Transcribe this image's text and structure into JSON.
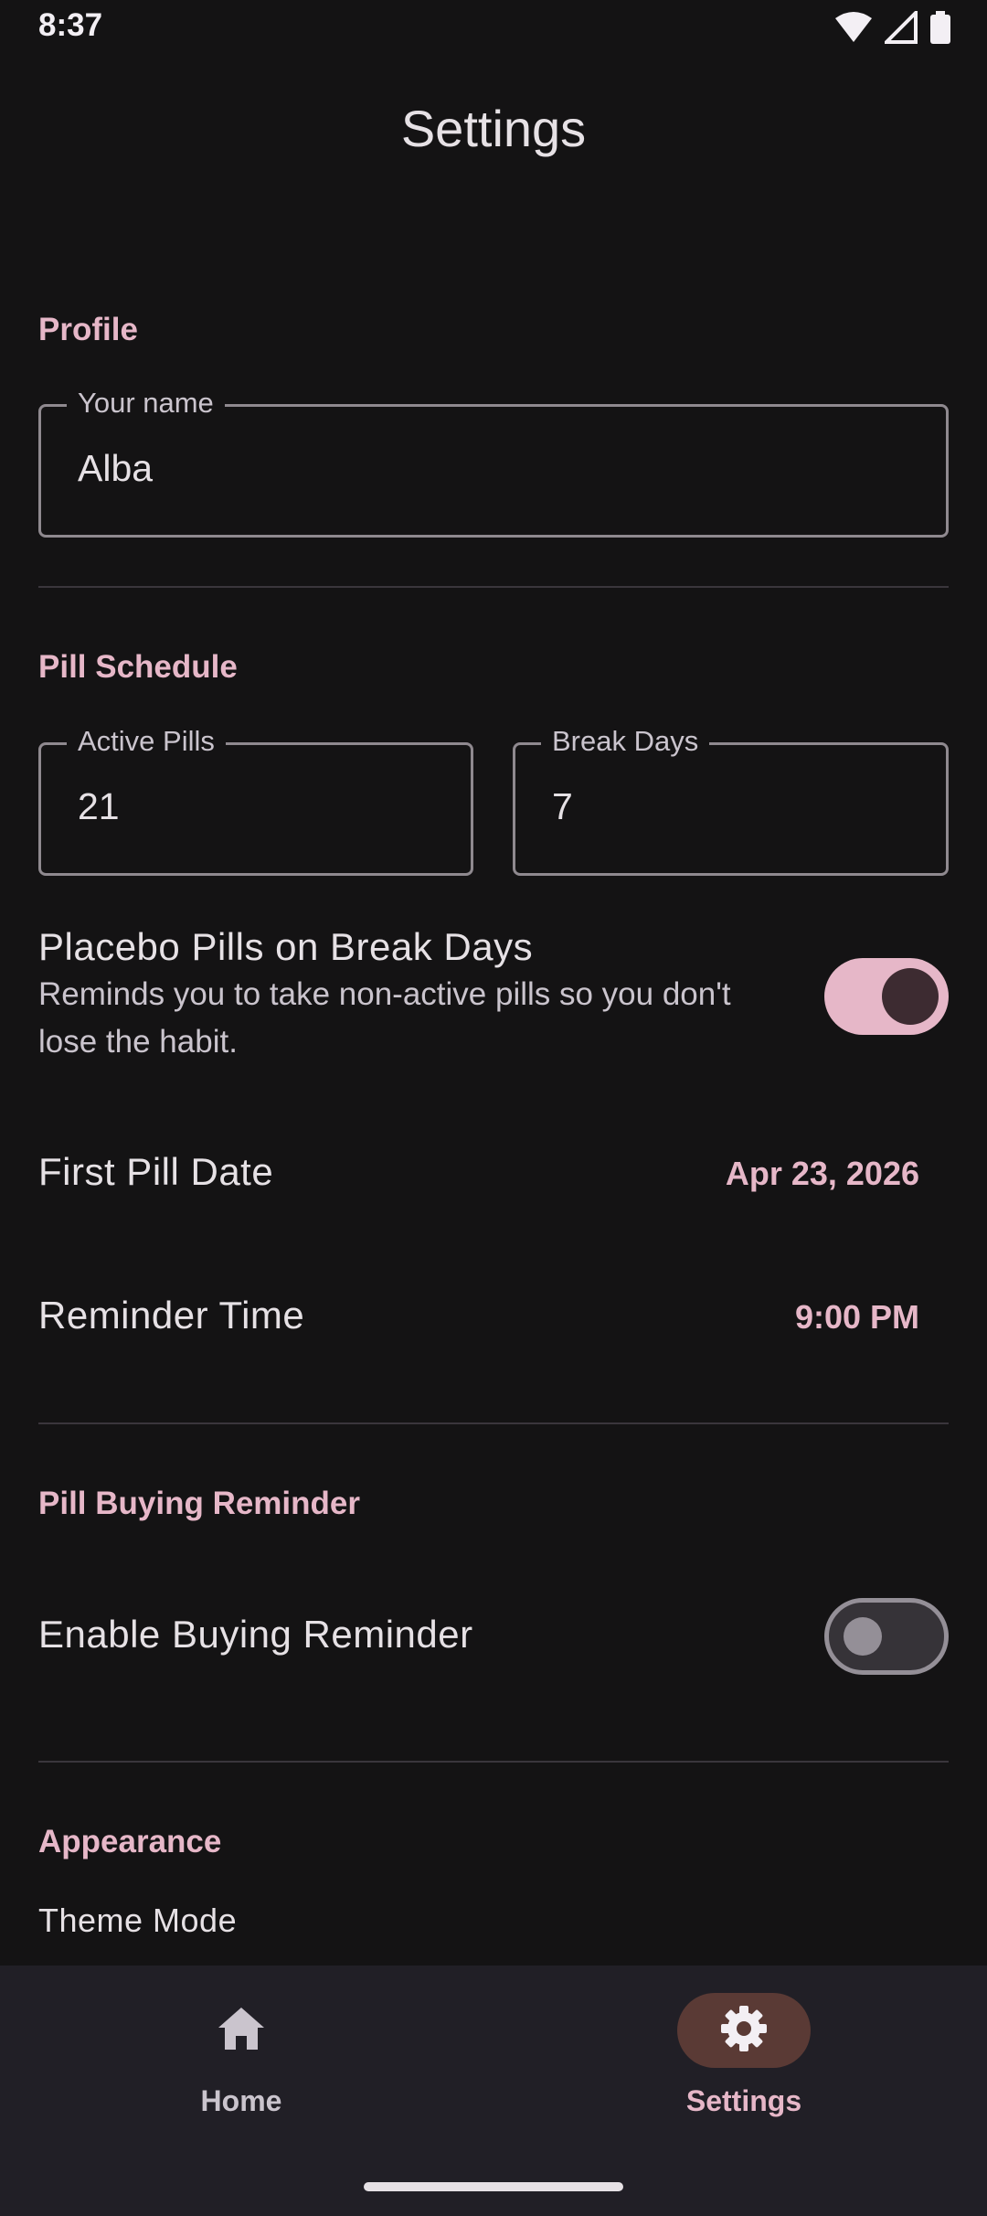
{
  "status_bar": {
    "time": "8:37",
    "icons": [
      "wifi-icon",
      "cellular-signal-icon",
      "battery-icon"
    ]
  },
  "app_bar": {
    "title": "Settings"
  },
  "profile": {
    "header": "Profile",
    "name_field": {
      "label": "Your name",
      "value": "Alba"
    }
  },
  "pill_schedule": {
    "header": "Pill Schedule",
    "active_pills": {
      "label": "Active Pills",
      "value": "21"
    },
    "break_days": {
      "label": "Break Days",
      "value": "7"
    },
    "placebo": {
      "title": "Placebo Pills on Break Days",
      "description": "Reminds you to take non-active pills so you don't lose the habit.",
      "enabled": true
    },
    "first_pill_date": {
      "label": "First Pill Date",
      "value": "Apr 23, 2026"
    },
    "reminder_time": {
      "label": "Reminder Time",
      "value": "9:00 PM"
    }
  },
  "pill_buying": {
    "header": "Pill Buying Reminder",
    "enable": {
      "label": "Enable Buying Reminder",
      "enabled": false
    }
  },
  "appearance": {
    "header": "Appearance",
    "theme_mode_label": "Theme Mode"
  },
  "bottom_nav": {
    "items": [
      {
        "label": "Home",
        "icon": "home-icon",
        "active": false
      },
      {
        "label": "Settings",
        "icon": "gear-icon",
        "active": true
      }
    ]
  },
  "colors": {
    "background": "#141314",
    "accent": "#e6b7c8",
    "nav_background": "#211f26",
    "nav_active_indicator": "#5a3a35"
  }
}
